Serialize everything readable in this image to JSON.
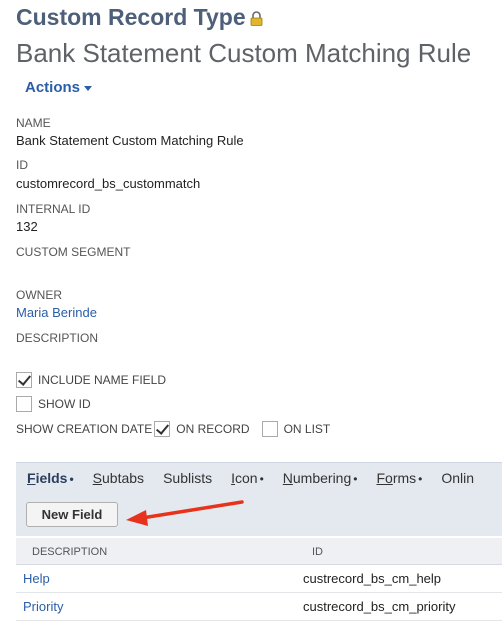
{
  "header": {
    "record_type": "Custom Record Type",
    "title": "Bank Statement Custom Matching Rule",
    "lock_icon": "lock-icon"
  },
  "actions": {
    "label": "Actions"
  },
  "fields": {
    "name_label": "NAME",
    "name_value": "Bank Statement Custom Matching Rule",
    "id_label": "ID",
    "id_value": "customrecord_bs_custommatch",
    "internal_id_label": "INTERNAL ID",
    "internal_id_value": "132",
    "custom_segment_label": "CUSTOM SEGMENT",
    "owner_label": "OWNER",
    "owner_value": "Maria Berinde",
    "description_label": "DESCRIPTION"
  },
  "checkboxes": {
    "include_name_field": {
      "label": "INCLUDE NAME FIELD",
      "checked": true
    },
    "show_id": {
      "label": "SHOW ID",
      "checked": false
    },
    "show_creation_date_label": "SHOW CREATION DATE",
    "on_record": {
      "label": "ON RECORD",
      "checked": true
    },
    "on_list": {
      "label": "ON LIST",
      "checked": false
    }
  },
  "tabs": [
    {
      "first": "F",
      "rest": "ields",
      "dot": "•",
      "active": true
    },
    {
      "first": "S",
      "rest": "ubtabs",
      "dot": "",
      "active": false
    },
    {
      "first": "S",
      "rest": "ublists",
      "dot": "",
      "active": false
    },
    {
      "first": "I",
      "rest": "con",
      "dot": "•",
      "active": false
    },
    {
      "first": "N",
      "rest": "umbering",
      "dot": "•",
      "active": false
    },
    {
      "first": "Fo",
      "rest": "rms",
      "dot": "•",
      "active": false
    },
    {
      "first": "",
      "rest": "Onlin",
      "dot": "",
      "active": false
    }
  ],
  "new_field_button": "New Field",
  "table": {
    "headers": [
      "DESCRIPTION",
      "ID"
    ],
    "rows": [
      [
        "Help",
        "custrecord_bs_cm_help"
      ],
      [
        "Priority",
        "custrecord_bs_cm_priority"
      ]
    ]
  },
  "colors": {
    "accent": "#2a5ea8",
    "annotation_arrow": "#e8331c"
  }
}
